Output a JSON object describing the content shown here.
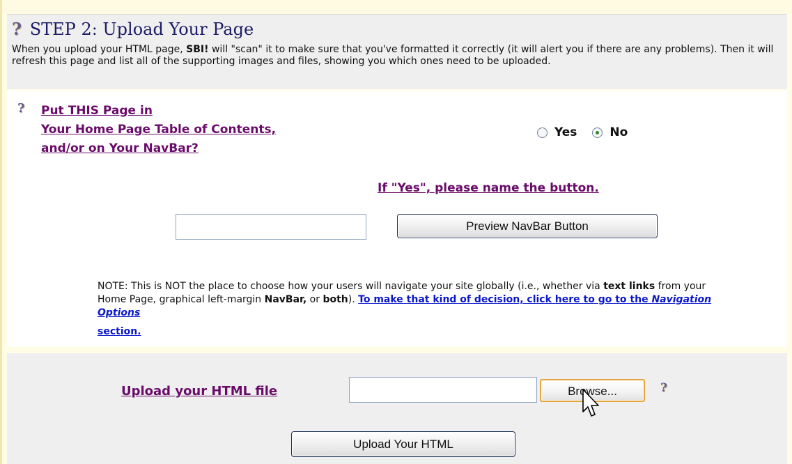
{
  "step": {
    "title": "STEP 2: Upload Your Page",
    "description_pre": "When you upload your HTML page, ",
    "description_brand": "SBI!",
    "description_post": " will \"scan\" it to make sure that you've formatted it correctly (it will alert you if there are any problems). Then it will refresh this page and list all of the supporting images and files, showing you which ones need to be uploaded."
  },
  "toc": {
    "line1": "Put THIS Page in",
    "line2": "Your Home Page Table of Contents,",
    "line3": "and/or on Your NavBar?",
    "options": [
      {
        "label": "Yes",
        "selected": false
      },
      {
        "label": "No",
        "selected": true
      }
    ]
  },
  "navbar": {
    "prompt": "If \"Yes\", please name the button.",
    "button_name_value": "",
    "preview_button": "Preview NavBar Button"
  },
  "note": {
    "part1": "NOTE: This is NOT the place to choose how your users will navigate your site globally (i.e., whether via ",
    "text_links": "text links",
    "part2": " from your Home Page, graphical left-margin ",
    "navbar": "NavBar,",
    "part3": " or ",
    "both": "both",
    "part4": "). ",
    "link_text": "To make that kind of decision, click here to go to the ",
    "link_italic": "Navigation Options",
    "link_tail": "section."
  },
  "upload": {
    "label": "Upload your HTML file",
    "file_value": "",
    "browse_button": "Browse...",
    "submit_button": "Upload Your HTML"
  },
  "icons": {
    "help": "?",
    "help_icon_name": "help-question-icon",
    "cursor_icon_name": "mouse-pointer-icon"
  },
  "colors": {
    "accent_purple": "#6a0b6a",
    "link_blue": "#0a17c9",
    "title_navy": "#1c1c66",
    "radio_checked": "#2e8a2e"
  }
}
